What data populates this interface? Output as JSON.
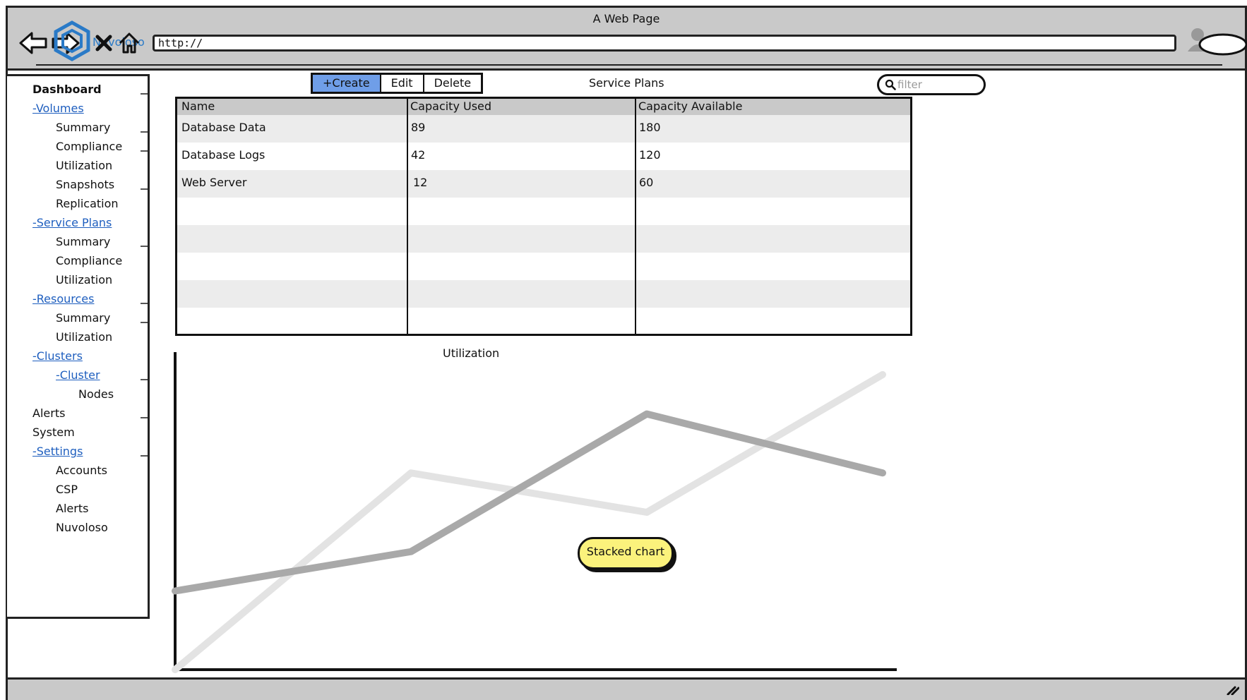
{
  "window": {
    "title": "A Web Page",
    "url": "http://",
    "logo_text": "Nuvoloso"
  },
  "sidebar": {
    "items": [
      {
        "label": "Dashboard"
      },
      {
        "label": "-Volumes"
      },
      {
        "label": "Summary"
      },
      {
        "label": "Compliance"
      },
      {
        "label": "Utilization"
      },
      {
        "label": "Snapshots"
      },
      {
        "label": "Replication"
      },
      {
        "label": "-Service Plans"
      },
      {
        "label": "Summary"
      },
      {
        "label": "Compliance"
      },
      {
        "label": "Utilization"
      },
      {
        "label": "-Resources"
      },
      {
        "label": "Summary"
      },
      {
        "label": "Utilization"
      },
      {
        "label": "-Clusters"
      },
      {
        "label": "-Cluster"
      },
      {
        "label": "Nodes"
      },
      {
        "label": "Alerts"
      },
      {
        "label": "System"
      },
      {
        "label": "-Settings"
      },
      {
        "label": "Accounts"
      },
      {
        "label": "CSP"
      },
      {
        "label": "Alerts"
      },
      {
        "label": "Nuvoloso"
      }
    ]
  },
  "toolbar": {
    "create_label": "+Create",
    "edit_label": "Edit",
    "delete_label": "Delete"
  },
  "section": {
    "title": "Service Plans"
  },
  "filter": {
    "placeholder": "filter"
  },
  "table": {
    "headers": [
      "Name",
      "Capacity Used",
      "Capacity Available"
    ],
    "rows": [
      [
        "Database Data",
        "89",
        "180"
      ],
      [
        "Database Logs",
        "42",
        "120"
      ],
      [
        "Web Server",
        "12",
        "60"
      ]
    ]
  },
  "chart": {
    "title": "Utilization",
    "note": "Stacked chart"
  },
  "chart_data": {
    "type": "line",
    "title": "Utilization",
    "x": [
      0,
      1,
      2,
      3
    ],
    "series": [
      {
        "values": [
          0,
          5,
          4,
          7.5
        ],
        "color": "#e3e3e3"
      },
      {
        "values": [
          2,
          3,
          6.5,
          5
        ],
        "color": "#a9a9a9"
      }
    ],
    "ylim": [
      0,
      8
    ],
    "grid": false,
    "axes": "left-bottom"
  },
  "colors": {
    "chrome": "#c9c9c9",
    "primary_button": "#6f9ee8",
    "note": "#fbf27c",
    "link": "#1f5fbf"
  }
}
